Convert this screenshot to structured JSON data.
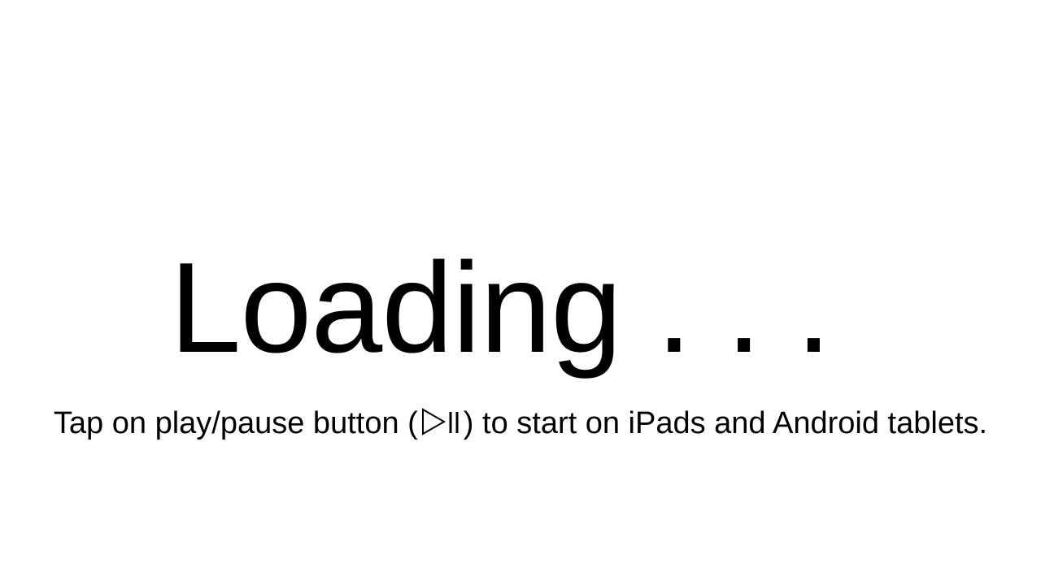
{
  "loading": {
    "text": "Loading . . ."
  },
  "instruction": {
    "before_icon": "Tap on play/pause button (",
    "after_icon": ") to start on iPads and Android tablets.",
    "icon": "play-pause-icon"
  },
  "colors": {
    "background": "#ffffff",
    "text": "#000000"
  }
}
